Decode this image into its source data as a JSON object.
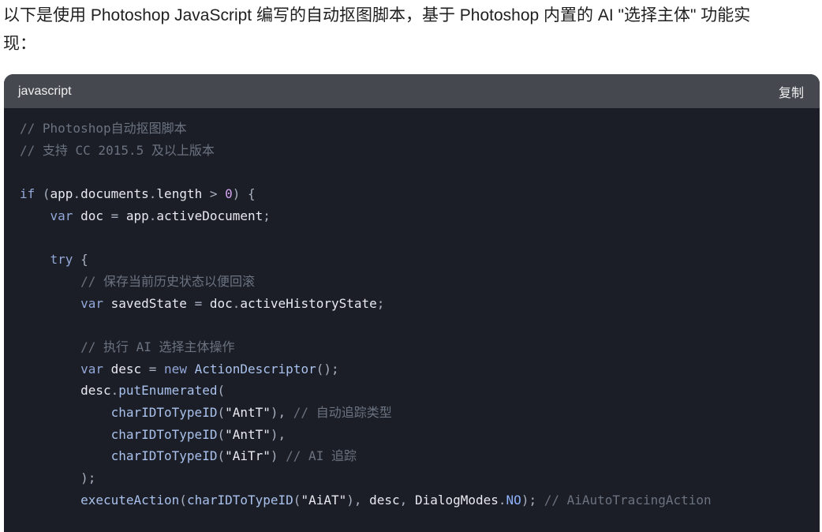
{
  "intro": {
    "line1": "以下是使用 Photoshop JavaScript 编写的自动抠图脚本，基于 Photoshop 内置的 AI \"选择主体\" 功能实",
    "line2": "现："
  },
  "code_block": {
    "language": "javascript",
    "copy_label": "复制",
    "lines": [
      [
        {
          "t": "comment",
          "v": "// Photoshop自动抠图脚本"
        }
      ],
      [
        {
          "t": "comment",
          "v": "// 支持 CC 2015.5 及以上版本"
        }
      ],
      [],
      [
        {
          "t": "keyword",
          "v": "if"
        },
        {
          "t": "punct",
          "v": " ("
        },
        {
          "t": "ident",
          "v": "app"
        },
        {
          "t": "punct",
          "v": "."
        },
        {
          "t": "ident",
          "v": "documents"
        },
        {
          "t": "punct",
          "v": "."
        },
        {
          "t": "ident",
          "v": "length"
        },
        {
          "t": "punct",
          "v": " > "
        },
        {
          "t": "number",
          "v": "0"
        },
        {
          "t": "punct",
          "v": ") {"
        }
      ],
      [
        {
          "t": "punct",
          "v": "    "
        },
        {
          "t": "keyword",
          "v": "var"
        },
        {
          "t": "ident",
          "v": " doc"
        },
        {
          "t": "punct",
          "v": " = "
        },
        {
          "t": "ident",
          "v": "app"
        },
        {
          "t": "punct",
          "v": "."
        },
        {
          "t": "ident",
          "v": "activeDocument"
        },
        {
          "t": "punct",
          "v": ";"
        }
      ],
      [],
      [
        {
          "t": "punct",
          "v": "    "
        },
        {
          "t": "keyword",
          "v": "try"
        },
        {
          "t": "punct",
          "v": " {"
        }
      ],
      [
        {
          "t": "punct",
          "v": "        "
        },
        {
          "t": "comment",
          "v": "// 保存当前历史状态以便回滚"
        }
      ],
      [
        {
          "t": "punct",
          "v": "        "
        },
        {
          "t": "keyword",
          "v": "var"
        },
        {
          "t": "ident",
          "v": " savedState"
        },
        {
          "t": "punct",
          "v": " = "
        },
        {
          "t": "ident",
          "v": "doc"
        },
        {
          "t": "punct",
          "v": "."
        },
        {
          "t": "ident",
          "v": "activeHistoryState"
        },
        {
          "t": "punct",
          "v": ";"
        }
      ],
      [],
      [
        {
          "t": "punct",
          "v": "        "
        },
        {
          "t": "comment",
          "v": "// 执行 AI 选择主体操作"
        }
      ],
      [
        {
          "t": "punct",
          "v": "        "
        },
        {
          "t": "keyword",
          "v": "var"
        },
        {
          "t": "ident",
          "v": " desc"
        },
        {
          "t": "punct",
          "v": " = "
        },
        {
          "t": "keyword",
          "v": "new"
        },
        {
          "t": "func",
          "v": " ActionDescriptor"
        },
        {
          "t": "punct",
          "v": "();"
        }
      ],
      [
        {
          "t": "punct",
          "v": "        "
        },
        {
          "t": "ident",
          "v": "desc"
        },
        {
          "t": "punct",
          "v": "."
        },
        {
          "t": "func",
          "v": "putEnumerated"
        },
        {
          "t": "punct",
          "v": "("
        }
      ],
      [
        {
          "t": "punct",
          "v": "            "
        },
        {
          "t": "func",
          "v": "charIDToTypeID"
        },
        {
          "t": "punct",
          "v": "("
        },
        {
          "t": "string",
          "v": "\"AntT\""
        },
        {
          "t": "punct",
          "v": "), "
        },
        {
          "t": "comment",
          "v": "// 自动追踪类型"
        }
      ],
      [
        {
          "t": "punct",
          "v": "            "
        },
        {
          "t": "func",
          "v": "charIDToTypeID"
        },
        {
          "t": "punct",
          "v": "("
        },
        {
          "t": "string",
          "v": "\"AntT\""
        },
        {
          "t": "punct",
          "v": "),"
        }
      ],
      [
        {
          "t": "punct",
          "v": "            "
        },
        {
          "t": "func",
          "v": "charIDToTypeID"
        },
        {
          "t": "punct",
          "v": "("
        },
        {
          "t": "string",
          "v": "\"AiTr\""
        },
        {
          "t": "punct",
          "v": ") "
        },
        {
          "t": "comment",
          "v": "// AI 追踪"
        }
      ],
      [
        {
          "t": "punct",
          "v": "        );"
        }
      ],
      [
        {
          "t": "punct",
          "v": "        "
        },
        {
          "t": "func",
          "v": "executeAction"
        },
        {
          "t": "punct",
          "v": "("
        },
        {
          "t": "func",
          "v": "charIDToTypeID"
        },
        {
          "t": "punct",
          "v": "("
        },
        {
          "t": "string",
          "v": "\"AiAT\""
        },
        {
          "t": "punct",
          "v": "), "
        },
        {
          "t": "ident",
          "v": "desc"
        },
        {
          "t": "punct",
          "v": ", "
        },
        {
          "t": "ident",
          "v": "DialogModes"
        },
        {
          "t": "punct",
          "v": "."
        },
        {
          "t": "const",
          "v": "NO"
        },
        {
          "t": "punct",
          "v": "); "
        },
        {
          "t": "comment",
          "v": "// AiAutoTracingAction"
        }
      ]
    ]
  },
  "colors": {
    "page_bg": "#ffffff",
    "code_bg": "#1b1e26",
    "header_bg": "#464850",
    "comment": "#6b7280",
    "keyword": "#93a8d9"
  }
}
